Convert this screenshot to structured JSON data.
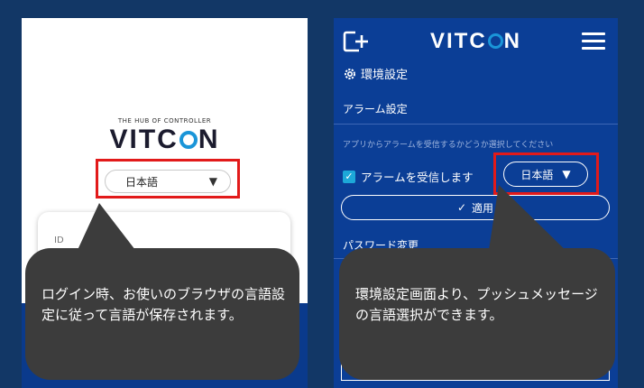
{
  "left": {
    "tagline": "THE HUB OF CONTROLLER",
    "logo_pre": "VITC",
    "logo_post": "N",
    "language": "日本語",
    "id_label": "ID"
  },
  "right": {
    "logo_pre": "VITC",
    "logo_post": "N",
    "env_title": "環境設定",
    "alarm_heading": "アラーム設定",
    "alarm_desc": "アプリからアラームを受信するかどうか選択してください",
    "alarm_check_label": "アラームを受信します",
    "alarm_checked": true,
    "language": "日本語",
    "apply_label": "適用",
    "password_heading": "パスワード変更"
  },
  "callouts": {
    "left": "ログイン時、お使いのブラウザの言語設定に従って言語が保存されます。",
    "right": "環境設定画面より、プッシュメッセージの言語選択ができます。"
  },
  "colors": {
    "background": "#123766",
    "app_blue": "#0b3e96",
    "accent": "#1a95d8",
    "highlight_red": "#e21a1a",
    "bubble": "#3c3c3c"
  }
}
